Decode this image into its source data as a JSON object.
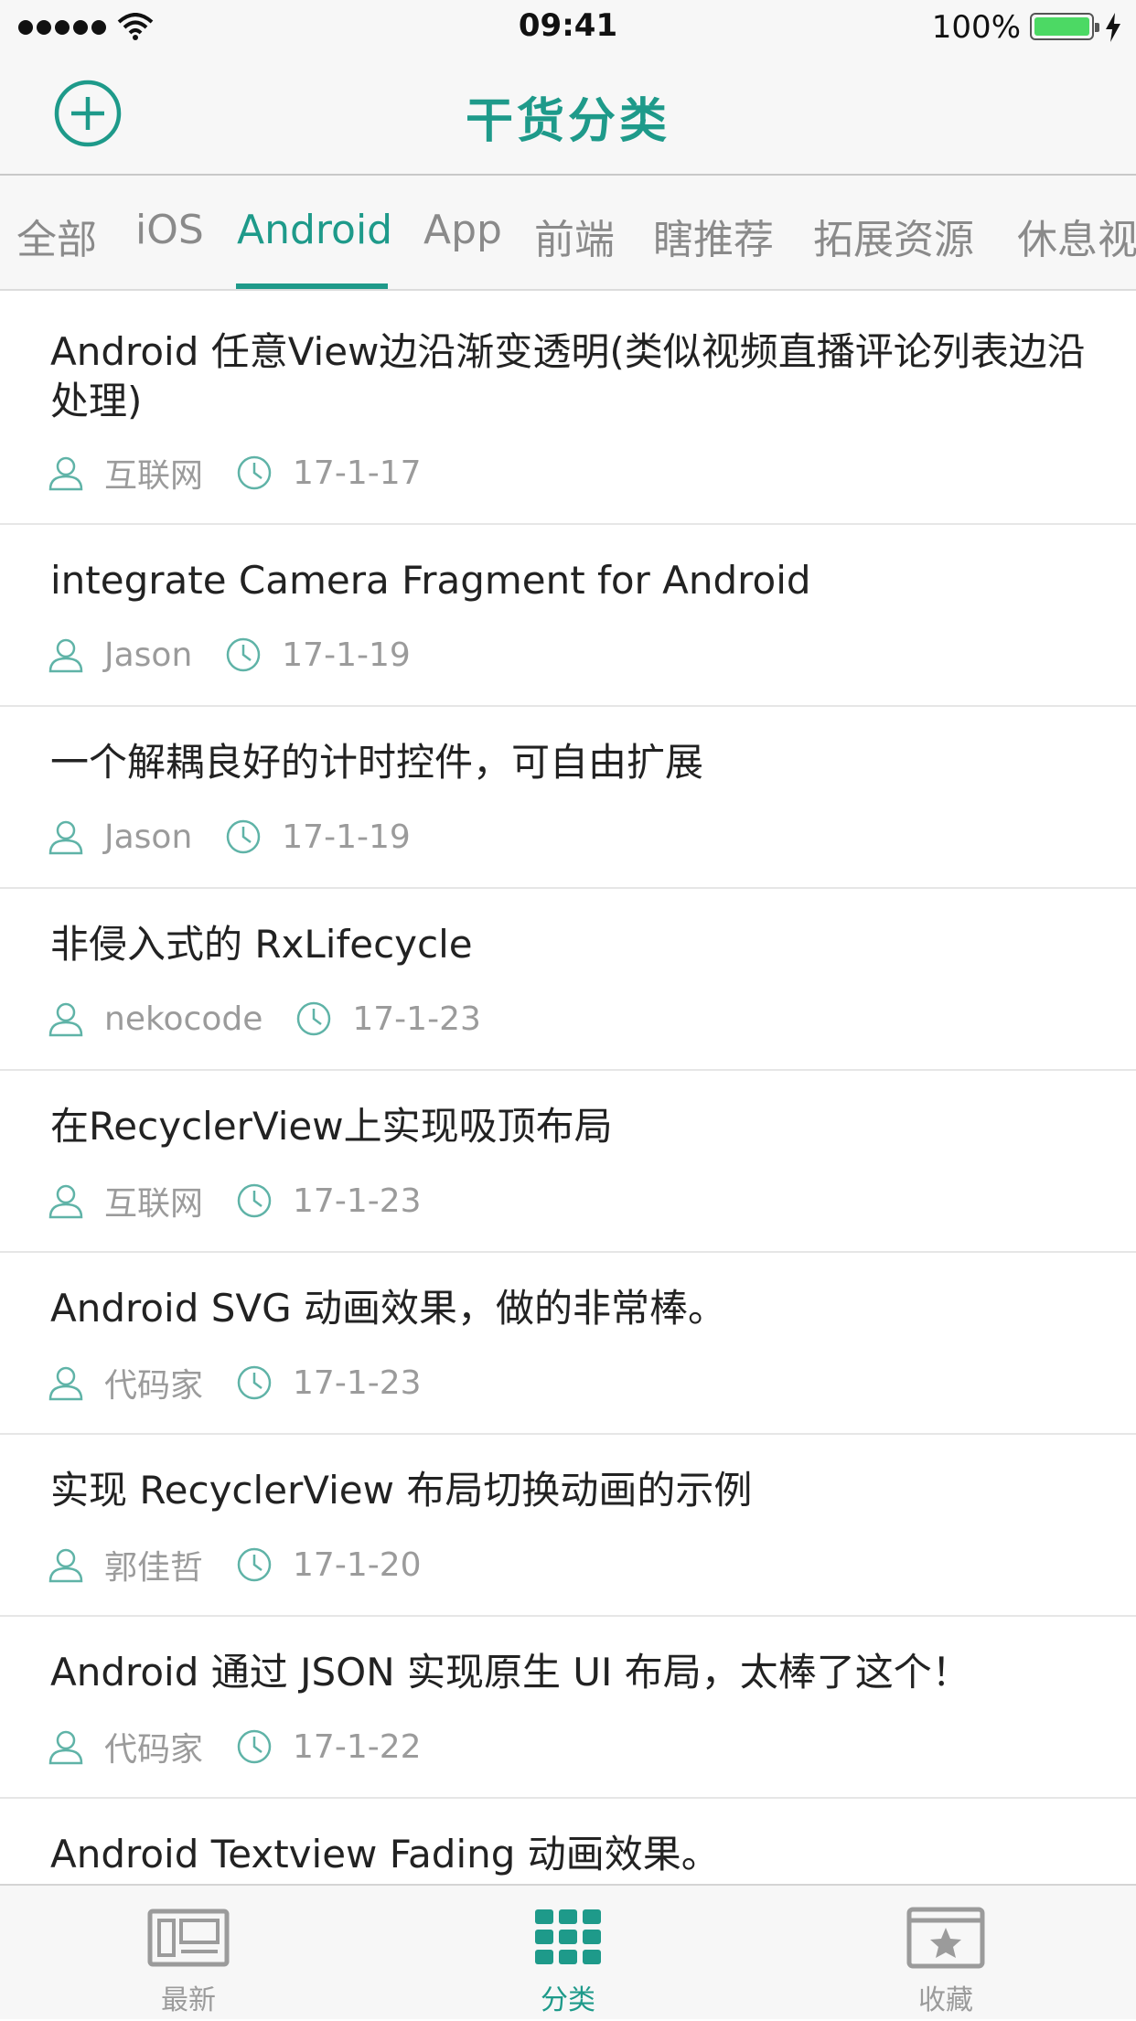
{
  "status_bar": {
    "time": "09:41",
    "battery": "100%"
  },
  "nav": {
    "title": "干货分类",
    "add_icon": "plus-circle-icon"
  },
  "tabs": [
    {
      "label": "全部"
    },
    {
      "label": "iOS"
    },
    {
      "label": "Android"
    },
    {
      "label": "App"
    },
    {
      "label": "前端"
    },
    {
      "label": "瞎推荐"
    },
    {
      "label": "拓展资源"
    },
    {
      "label": "休息视"
    }
  ],
  "active_tab": "Android",
  "accent_color": "#1e9a8a",
  "articles": [
    {
      "title": "Android 任意View边沿渐变透明(类似视频直播评论列表边沿处理)",
      "author": "互联网",
      "date": "17-1-17"
    },
    {
      "title": "integrate Camera Fragment for Android",
      "author": "Jason",
      "date": "17-1-19"
    },
    {
      "title": "一个解耦良好的计时控件，可自由扩展",
      "author": "Jason",
      "date": "17-1-19"
    },
    {
      "title": "非侵入式的 RxLifecycle",
      "author": "nekocode",
      "date": "17-1-23"
    },
    {
      "title": "在RecyclerView上实现吸顶布局",
      "author": "互联网",
      "date": "17-1-23"
    },
    {
      "title": "Android SVG 动画效果，做的非常棒。",
      "author": "代码家",
      "date": "17-1-23"
    },
    {
      "title": "实现 RecyclerView 布局切换动画的示例",
      "author": "郭佳哲",
      "date": "17-1-20"
    },
    {
      "title": "Android 通过 JSON 实现原生 UI 布局，太棒了这个！",
      "author": "代码家",
      "date": "17-1-22"
    },
    {
      "title": "Android Textview Fading 动画效果。",
      "author": "",
      "date": ""
    }
  ],
  "tabbar": [
    {
      "label": "最新",
      "icon": "newspaper-icon"
    },
    {
      "label": "分类",
      "icon": "grid-icon"
    },
    {
      "label": "收藏",
      "icon": "star-box-icon"
    }
  ]
}
